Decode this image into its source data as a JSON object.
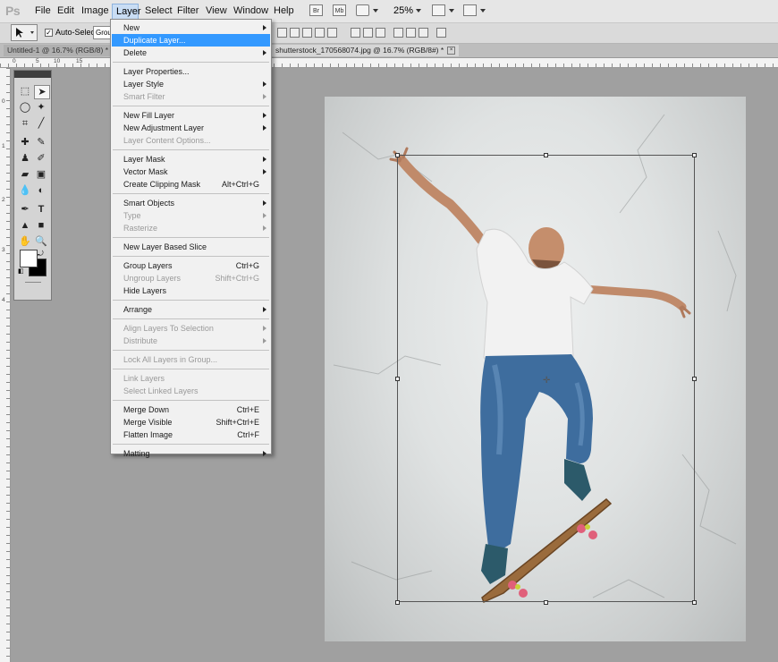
{
  "app": {
    "logo": "Ps"
  },
  "menubar": {
    "items": [
      "File",
      "Edit",
      "Image",
      "Layer",
      "Select",
      "Filter",
      "View",
      "Window",
      "Help"
    ],
    "bridge_label": "Br",
    "minibridge_label": "Mb",
    "zoom": "25%"
  },
  "options": {
    "auto_select_label": "Auto-Select:",
    "auto_select_value": "Grou"
  },
  "tabs": [
    {
      "label": "Untitled-1 @ 16.7% (RGB/8) *"
    },
    {
      "label": "shutterstock_170568074.jpg @ 16.7% (RGB/8#) *"
    }
  ],
  "ruler": {
    "h_marks": [
      "0",
      "5",
      "10",
      "15"
    ],
    "v_marks": [
      "0",
      "1",
      "2",
      "3",
      "4"
    ]
  },
  "layer_menu": {
    "items": [
      {
        "label": "New",
        "arrow": true
      },
      {
        "label": "Duplicate Layer...",
        "active": true
      },
      {
        "label": "Delete",
        "arrow": true
      },
      {
        "sep": true
      },
      {
        "label": "Layer Properties..."
      },
      {
        "label": "Layer Style",
        "arrow": true
      },
      {
        "label": "Smart Filter",
        "arrow": true,
        "disabled": true
      },
      {
        "sep": true
      },
      {
        "label": "New Fill Layer",
        "arrow": true
      },
      {
        "label": "New Adjustment Layer",
        "arrow": true
      },
      {
        "label": "Layer Content Options...",
        "disabled": true
      },
      {
        "sep": true
      },
      {
        "label": "Layer Mask",
        "arrow": true
      },
      {
        "label": "Vector Mask",
        "arrow": true
      },
      {
        "label": "Create Clipping Mask",
        "shortcut": "Alt+Ctrl+G"
      },
      {
        "sep": true
      },
      {
        "label": "Smart Objects",
        "arrow": true
      },
      {
        "label": "Type",
        "arrow": true,
        "disabled": true
      },
      {
        "label": "Rasterize",
        "arrow": true,
        "disabled": true
      },
      {
        "sep": true
      },
      {
        "label": "New Layer Based Slice"
      },
      {
        "sep": true
      },
      {
        "label": "Group Layers",
        "shortcut": "Ctrl+G"
      },
      {
        "label": "Ungroup Layers",
        "shortcut": "Shift+Ctrl+G",
        "disabled": true
      },
      {
        "label": "Hide Layers"
      },
      {
        "sep": true
      },
      {
        "label": "Arrange",
        "arrow": true
      },
      {
        "sep": true
      },
      {
        "label": "Align Layers To Selection",
        "arrow": true,
        "disabled": true
      },
      {
        "label": "Distribute",
        "arrow": true,
        "disabled": true
      },
      {
        "sep": true
      },
      {
        "label": "Lock All Layers in Group...",
        "disabled": true
      },
      {
        "sep": true
      },
      {
        "label": "Link Layers",
        "disabled": true
      },
      {
        "label": "Select Linked Layers",
        "disabled": true
      },
      {
        "sep": true
      },
      {
        "label": "Merge Down",
        "shortcut": "Ctrl+E"
      },
      {
        "label": "Merge Visible",
        "shortcut": "Shift+Ctrl+E"
      },
      {
        "label": "Flatten Image",
        "shortcut": "Ctrl+F"
      },
      {
        "sep": true
      },
      {
        "label": "Matting",
        "arrow": true
      }
    ]
  },
  "toolbox": {
    "tools": [
      "move-tool-icon",
      "marquee-tool-icon",
      "lasso-tool-icon",
      "magic-wand-icon",
      "crop-tool-icon",
      "eyedropper-icon",
      "healing-brush-icon",
      "brush-tool-icon",
      "clone-stamp-icon",
      "history-brush-icon",
      "eraser-icon",
      "gradient-tool-icon",
      "blur-tool-icon",
      "dodge-tool-icon",
      "pen-tool-icon",
      "type-tool-icon",
      "path-selection-icon",
      "shape-tool-icon",
      "hand-tool-icon",
      "zoom-tool-icon"
    ],
    "fg_color": "#ffffff",
    "bg_color": "#000000"
  },
  "colors": {
    "menu_highlight": "#3399ff",
    "pasteboard": "#a0a0a0"
  }
}
